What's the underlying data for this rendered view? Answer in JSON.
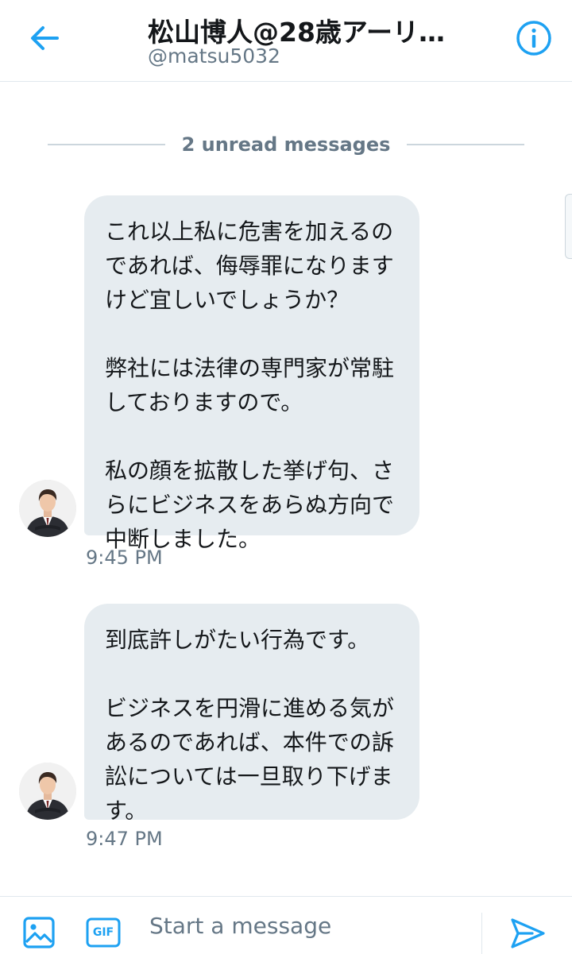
{
  "header": {
    "title": "松山博人@28歳アーリ…",
    "handle": "@matsu5032",
    "back_icon": "arrow-left-icon",
    "info_icon": "info-icon"
  },
  "conversation": {
    "unread_divider": "2 unread messages",
    "messages": [
      {
        "paragraphs": [
          "これ以上私に危害を加えるの\nであれば、侮辱罪になります\nけど宜しいでしょうか？",
          "弊社には法律の専門家が常駐\nしておりますので。",
          "私の顔を拡散した挙げ句、さ\nらにビジネスをあらぬ方向で\n中断しました。"
        ],
        "time": "9:45 PM"
      },
      {
        "paragraphs": [
          "到底許しがたい行為です。",
          "ビジネスを円滑に進める気が\nあるのであれば、本件での訴\n訟については一旦取り下げま\nす。"
        ],
        "time": "9:47 PM"
      }
    ]
  },
  "composer": {
    "placeholder": "Start a message",
    "gif_label": "GIF",
    "media_icon": "image-icon",
    "send_icon": "send-icon"
  },
  "colors": {
    "accent": "#1da1f2",
    "bubble": "#e6ecf0",
    "secondary_text": "#657786",
    "border": "#e1e8ed"
  }
}
